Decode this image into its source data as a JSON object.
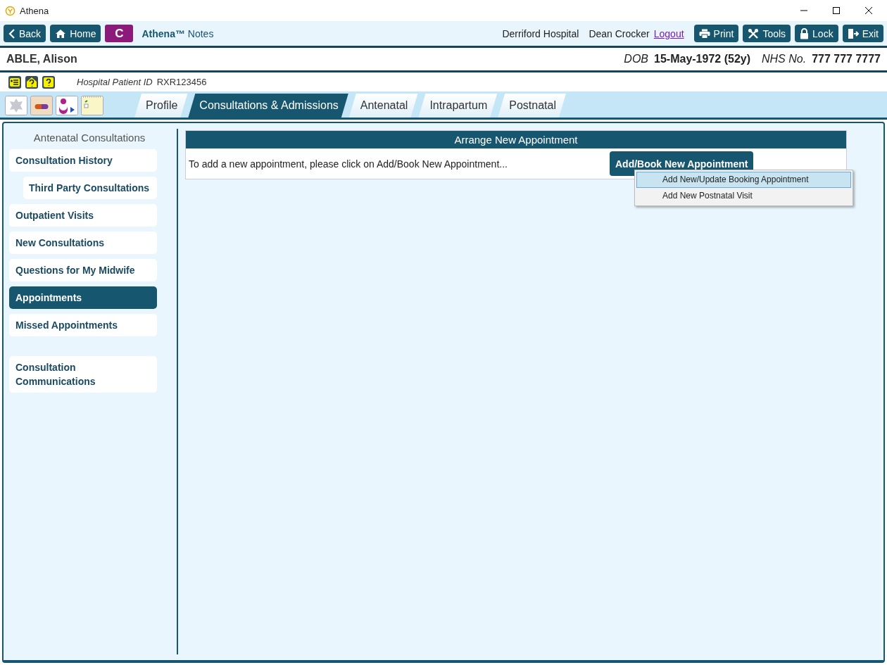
{
  "window": {
    "title": "Athena"
  },
  "toolbar": {
    "left_buttons": [
      {
        "label": "Back",
        "kind": "back"
      },
      {
        "label": "Home",
        "kind": "home"
      }
    ],
    "badge": "C",
    "app_name": "**Athena™** Notes",
    "hospital": "Derriford Hospital",
    "user": "Dean Crocker",
    "logout": "Logout",
    "right_buttons": [
      {
        "label": "Print",
        "kind": "print"
      },
      {
        "label": "Tools",
        "kind": "tools"
      },
      {
        "label": "Lock",
        "kind": "lock"
      },
      {
        "label": "Exit",
        "kind": "exit"
      }
    ]
  },
  "patient": {
    "name": "ABLE, Alison",
    "dob_label": "DOB",
    "dob": "15-May-1972 (52y)",
    "nhs_label": "NHS No.",
    "nhs": "777 777 7777",
    "id_label": "Hospital Patient ID",
    "id": "RXR123456"
  },
  "tabs": [
    {
      "label": "Profile",
      "selected": false
    },
    {
      "label": "Consultations & Admissions",
      "selected": true
    },
    {
      "label": "Antenatal",
      "selected": false
    },
    {
      "label": "Intrapartum",
      "selected": false
    },
    {
      "label": "Postnatal",
      "selected": false
    }
  ],
  "sidebar": {
    "title": "Antenatal Consultations",
    "groups": [
      {
        "items": [
          {
            "label": "Consultation History",
            "selected": false,
            "children": [
              {
                "label": "Third Party Consultations",
                "selected": false
              }
            ]
          },
          {
            "label": "Outpatient Visits",
            "selected": false
          },
          {
            "label": "New Consultations",
            "selected": false
          },
          {
            "label": "Questions for My Midwife",
            "selected": false
          },
          {
            "label": "Appointments",
            "selected": true
          },
          {
            "label": "Missed Appointments",
            "selected": false
          }
        ]
      },
      {
        "items": [
          {
            "label": "Consultation Communications",
            "selected": false
          }
        ]
      }
    ]
  },
  "panel": {
    "title": "Arrange New Appointment",
    "text": "To add a new appointment, please click on Add/Book New Appointment...",
    "button": "Add/Book New Appointment",
    "menu": [
      {
        "label": "Add New/Update Booking Appointment",
        "selected": true
      },
      {
        "label": "Add New Postnatal Visit",
        "selected": false
      }
    ]
  }
}
